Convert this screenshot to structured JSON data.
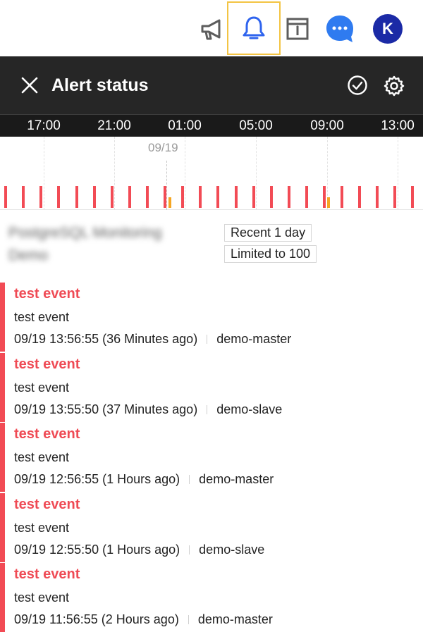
{
  "topbar": {
    "icons": [
      "megaphone-icon",
      "bell-icon",
      "news-icon",
      "chat-icon"
    ],
    "highlight_color": "#f3c443",
    "avatar_initial": "K",
    "avatar_color": "#1b2aa6"
  },
  "header": {
    "title": "Alert status",
    "close_icon": "close-icon",
    "check_icon": "check-circle-icon",
    "settings_icon": "gear-icon"
  },
  "timeline": {
    "ticks": [
      "17:00",
      "21:00",
      "01:00",
      "05:00",
      "09:00",
      "13:00"
    ],
    "date_marker": "09/19",
    "event_color": "#f24b55",
    "warning_color": "#f5a623"
  },
  "filter": {
    "project_name": "PostgreSQL Monitoring Demo",
    "range_chip": "Recent 1 day",
    "limit_chip": "Limited to 100"
  },
  "alerts": [
    {
      "title": "test event",
      "message": "test event",
      "time": "09/19 13:56:55 (36 Minutes ago)",
      "host": "demo-master"
    },
    {
      "title": "test event",
      "message": "test event",
      "time": "09/19 13:55:50 (37 Minutes ago)",
      "host": "demo-slave"
    },
    {
      "title": "test event",
      "message": "test event",
      "time": "09/19 12:56:55 (1 Hours ago)",
      "host": "demo-master"
    },
    {
      "title": "test event",
      "message": "test event",
      "time": "09/19 12:55:50 (1 Hours ago)",
      "host": "demo-slave"
    },
    {
      "title": "test event",
      "message": "test event",
      "time": "09/19 11:56:55 (2 Hours ago)",
      "host": "demo-master"
    }
  ]
}
